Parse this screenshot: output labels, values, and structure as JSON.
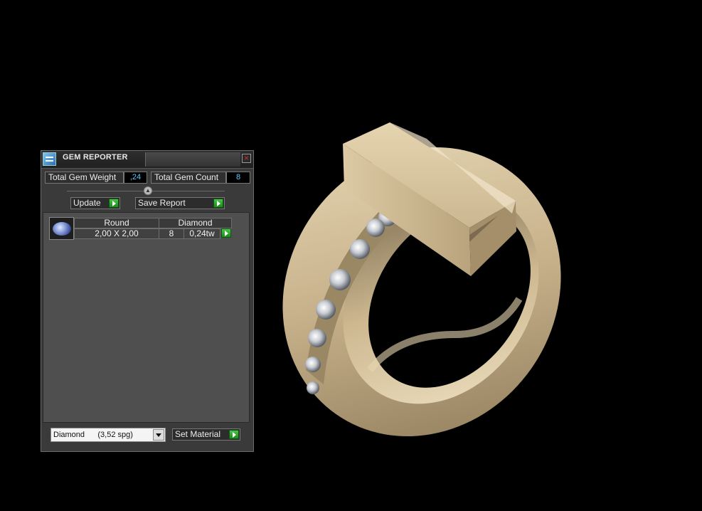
{
  "gem_reporter": {
    "title": "GEM REPORTER",
    "close_glyph": "×",
    "total_weight_label": "Total Gem Weight",
    "total_weight_value": ",24",
    "total_count_label": "Total Gem Count",
    "total_count_value": "8",
    "update_label": "Update",
    "save_report_label": "Save Report",
    "table": {
      "shape_header": "Round",
      "material_header": "Diamond",
      "size": "2,00 X 2,00",
      "count": "8",
      "weight": "0,24tw"
    },
    "material_select": "Diamond      (3,52 spg)",
    "set_material_label": "Set Material"
  },
  "icons": {
    "title_icon": "gem-reporter-app-icon",
    "close": "close-icon",
    "collapse": "chevron-up-icon",
    "go": "play-arrow-icon",
    "gem": "round-gem-icon",
    "dropdown": "chevron-down-icon"
  },
  "colors": {
    "background": "#000000",
    "panel": "#3a3a3a",
    "value_text": "#5ec8ff",
    "go_button": "#2aa52a",
    "ring_metal": "#c9b48e"
  }
}
